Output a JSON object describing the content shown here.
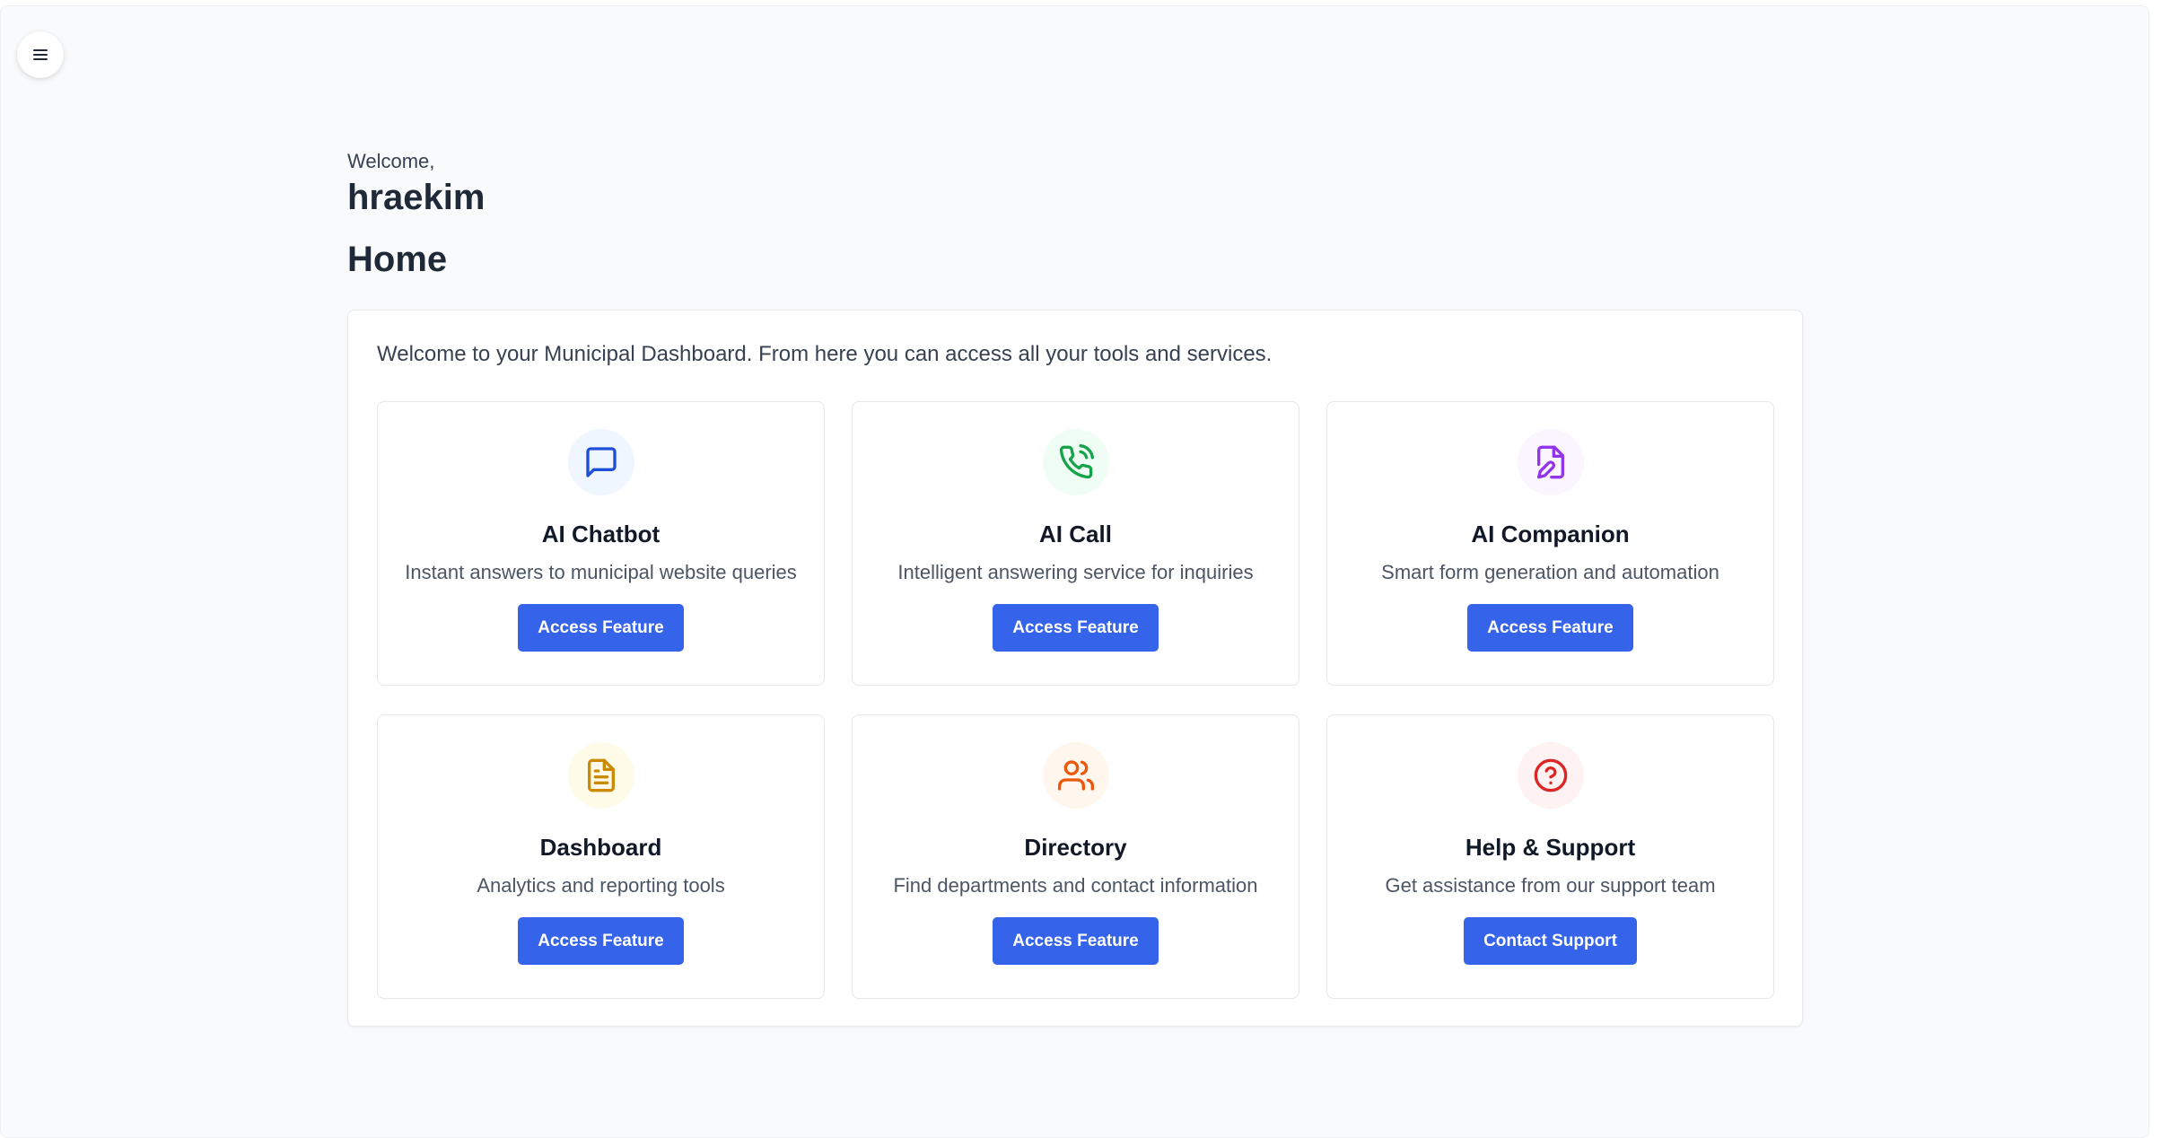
{
  "header": {
    "menu_icon": "hamburger-menu-icon",
    "welcome_label": "Welcome,",
    "username": "hraekim"
  },
  "page": {
    "title": "Home",
    "intro": "Welcome to your Municipal Dashboard. From here you can access all your tools and services."
  },
  "colors": {
    "primary_button": "#3563e9",
    "background": "#f9fafb"
  },
  "features": [
    {
      "title": "AI Chatbot",
      "description": "Instant answers to municipal website queries",
      "button": "Access Feature",
      "icon": "message-square-icon",
      "icon_color": "#1d4ed8",
      "icon_bg": "#eff6ff"
    },
    {
      "title": "AI Call",
      "description": "Intelligent answering service for inquiries",
      "button": "Access Feature",
      "icon": "phone-call-icon",
      "icon_color": "#16a34a",
      "icon_bg": "#f0fdf4"
    },
    {
      "title": "AI Companion",
      "description": "Smart form generation and automation",
      "button": "Access Feature",
      "icon": "file-edit-icon",
      "icon_color": "#9333ea",
      "icon_bg": "#faf5ff"
    },
    {
      "title": "Dashboard",
      "description": "Analytics and reporting tools",
      "button": "Access Feature",
      "icon": "file-text-icon",
      "icon_color": "#ca8a04",
      "icon_bg": "#fefce8"
    },
    {
      "title": "Directory",
      "description": "Find departments and contact information",
      "button": "Access Feature",
      "icon": "users-icon",
      "icon_color": "#ea580c",
      "icon_bg": "#fff7ed"
    },
    {
      "title": "Help & Support",
      "description": "Get assistance from our support team",
      "button": "Contact Support",
      "icon": "help-circle-icon",
      "icon_color": "#dc2626",
      "icon_bg": "#fef2f2"
    }
  ]
}
